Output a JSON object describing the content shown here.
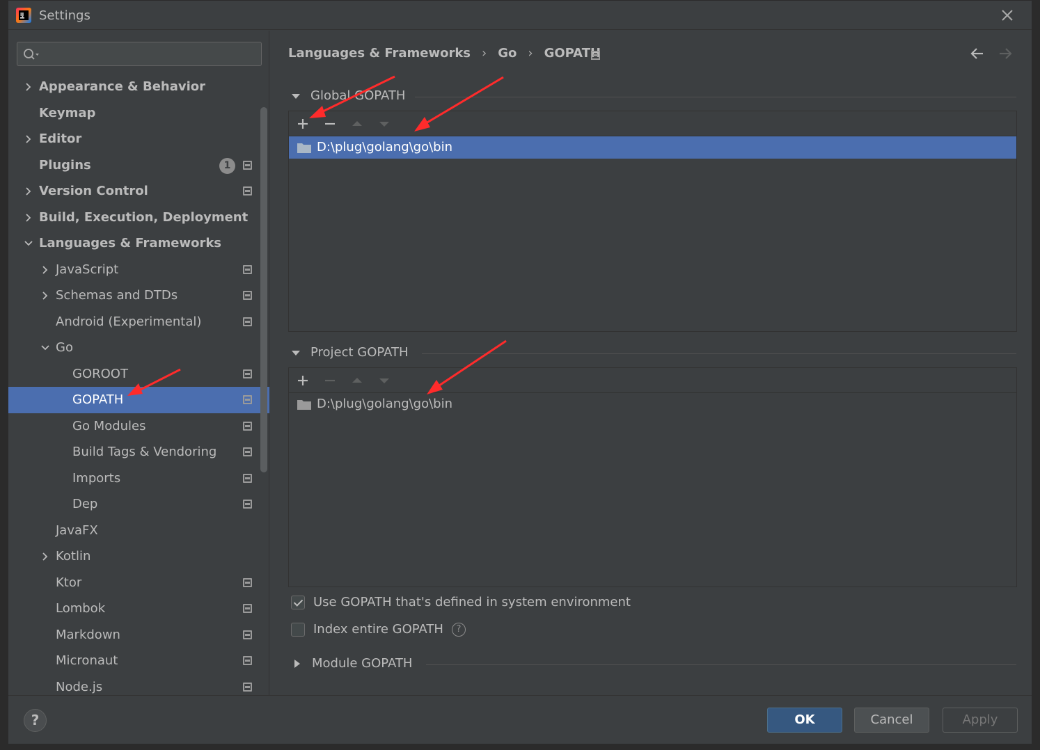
{
  "window": {
    "title": "Settings"
  },
  "search": {
    "placeholder": ""
  },
  "sidebar": {
    "items": [
      {
        "label": "Appearance & Behavior",
        "level": 0,
        "bold": true,
        "expandable": true,
        "expanded": false,
        "project_icon": false
      },
      {
        "label": "Keymap",
        "level": 0,
        "bold": true,
        "expandable": false,
        "project_icon": false
      },
      {
        "label": "Editor",
        "level": 0,
        "bold": true,
        "expandable": true,
        "expanded": false,
        "project_icon": false
      },
      {
        "label": "Plugins",
        "level": 0,
        "bold": true,
        "expandable": false,
        "project_icon": true,
        "badge": "1"
      },
      {
        "label": "Version Control",
        "level": 0,
        "bold": true,
        "expandable": true,
        "expanded": false,
        "project_icon": true
      },
      {
        "label": "Build, Execution, Deployment",
        "level": 0,
        "bold": true,
        "expandable": true,
        "expanded": false,
        "project_icon": false
      },
      {
        "label": "Languages & Frameworks",
        "level": 0,
        "bold": true,
        "expandable": true,
        "expanded": true,
        "project_icon": false
      },
      {
        "label": "JavaScript",
        "level": 1,
        "bold": false,
        "expandable": true,
        "expanded": false,
        "project_icon": true
      },
      {
        "label": "Schemas and DTDs",
        "level": 1,
        "bold": false,
        "expandable": true,
        "expanded": false,
        "project_icon": true
      },
      {
        "label": "Android (Experimental)",
        "level": 1,
        "bold": false,
        "expandable": false,
        "project_icon": true
      },
      {
        "label": "Go",
        "level": 1,
        "bold": false,
        "expandable": true,
        "expanded": true,
        "project_icon": false
      },
      {
        "label": "GOROOT",
        "level": 2,
        "bold": false,
        "expandable": false,
        "project_icon": true
      },
      {
        "label": "GOPATH",
        "level": 2,
        "bold": false,
        "expandable": false,
        "project_icon": true,
        "selected": true
      },
      {
        "label": "Go Modules",
        "level": 2,
        "bold": false,
        "expandable": false,
        "project_icon": true
      },
      {
        "label": "Build Tags & Vendoring",
        "level": 2,
        "bold": false,
        "expandable": false,
        "project_icon": true
      },
      {
        "label": "Imports",
        "level": 2,
        "bold": false,
        "expandable": false,
        "project_icon": true
      },
      {
        "label": "Dep",
        "level": 2,
        "bold": false,
        "expandable": false,
        "project_icon": true
      },
      {
        "label": "JavaFX",
        "level": 1,
        "bold": false,
        "expandable": false,
        "project_icon": false
      },
      {
        "label": "Kotlin",
        "level": 1,
        "bold": false,
        "expandable": true,
        "expanded": false,
        "project_icon": false
      },
      {
        "label": "Ktor",
        "level": 1,
        "bold": false,
        "expandable": false,
        "project_icon": true
      },
      {
        "label": "Lombok",
        "level": 1,
        "bold": false,
        "expandable": false,
        "project_icon": true
      },
      {
        "label": "Markdown",
        "level": 1,
        "bold": false,
        "expandable": false,
        "project_icon": true
      },
      {
        "label": "Micronaut",
        "level": 1,
        "bold": false,
        "expandable": false,
        "project_icon": true
      },
      {
        "label": "Node.js",
        "level": 1,
        "bold": false,
        "expandable": false,
        "project_icon": true
      }
    ]
  },
  "breadcrumb": {
    "parts": [
      "Languages & Frameworks",
      "Go",
      "GOPATH"
    ],
    "separator": "›"
  },
  "global_gopath": {
    "heading": "Global GOPATH",
    "paths": [
      "D:\\plug\\golang\\go\\bin"
    ]
  },
  "project_gopath": {
    "heading": "Project GOPATH",
    "paths": [
      "D:\\plug\\golang\\go\\bin"
    ]
  },
  "options": {
    "use_system_gopath": {
      "label": "Use GOPATH that's defined in system environment",
      "checked": true
    },
    "index_entire_gopath": {
      "label": "Index entire GOPATH",
      "checked": false
    }
  },
  "module_gopath": {
    "heading": "Module GOPATH"
  },
  "footer": {
    "help": "?",
    "ok": "OK",
    "cancel": "Cancel",
    "apply": "Apply"
  },
  "colors": {
    "background": "#3c3f41",
    "selection": "#4b6eaf",
    "ok_button": "#365880",
    "annotation_arrow": "#ff2b2b"
  }
}
